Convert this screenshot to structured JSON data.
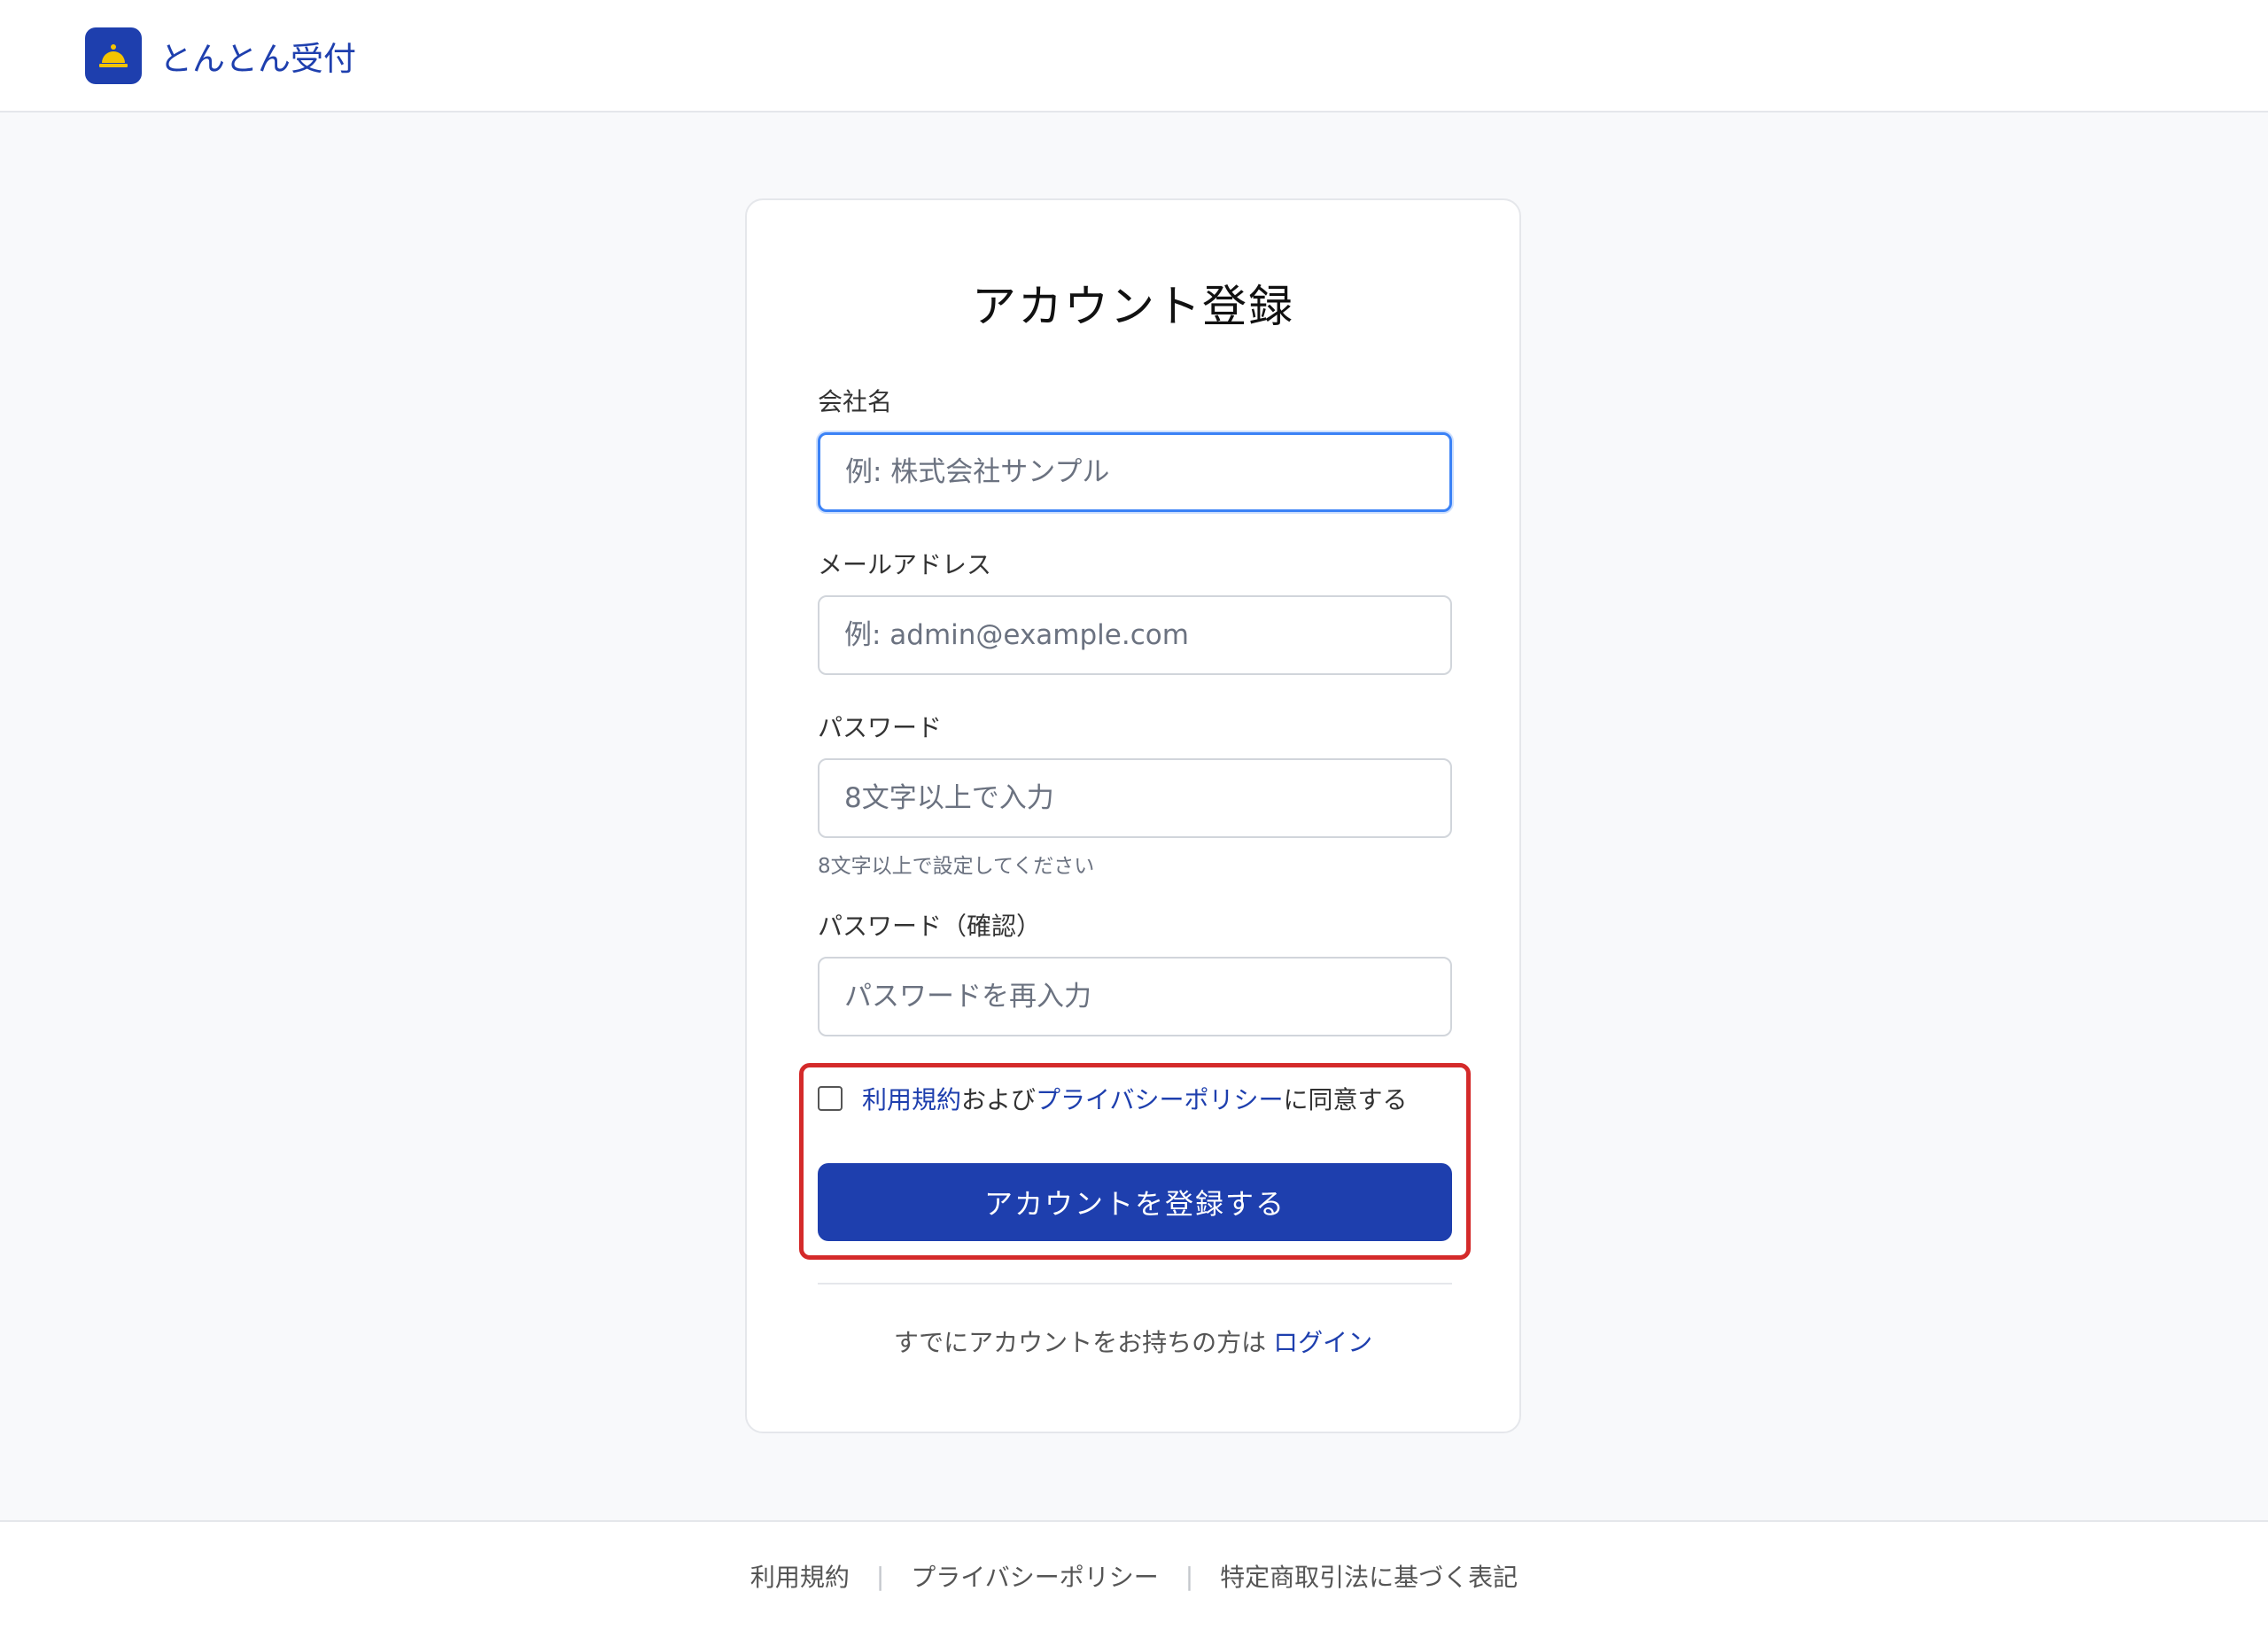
{
  "header": {
    "brand": "とんとん受付",
    "logo_icon": "bell-icon",
    "logo_bg": "#1e3fae",
    "bell_color": "#f5c400"
  },
  "form": {
    "title": "アカウント登録",
    "company": {
      "label": "会社名",
      "placeholder": "例: 株式会社サンプル"
    },
    "email": {
      "label": "メールアドレス",
      "placeholder": "例: admin@example.com"
    },
    "password": {
      "label": "パスワード",
      "placeholder": "8文字以上で入力",
      "hint": "8文字以上で設定してください"
    },
    "password_confirm": {
      "label": "パスワード（確認）",
      "placeholder": "パスワードを再入力"
    },
    "agree": {
      "terms_link": "利用規約",
      "conjunction": "および",
      "privacy_link": "プライバシーポリシー",
      "suffix": "に同意する",
      "checked": false
    },
    "submit_label": "アカウントを登録する",
    "login_prompt": "すでにアカウントをお持ちの方は",
    "login_link": "ログイン"
  },
  "footer": {
    "links": [
      "利用規約",
      "プライバシーポリシー",
      "特定商取引法に基づく表記"
    ],
    "separator": "|"
  },
  "colors": {
    "primary": "#1e3fae",
    "highlight": "#d42a2a",
    "focus": "#3b82f6"
  }
}
